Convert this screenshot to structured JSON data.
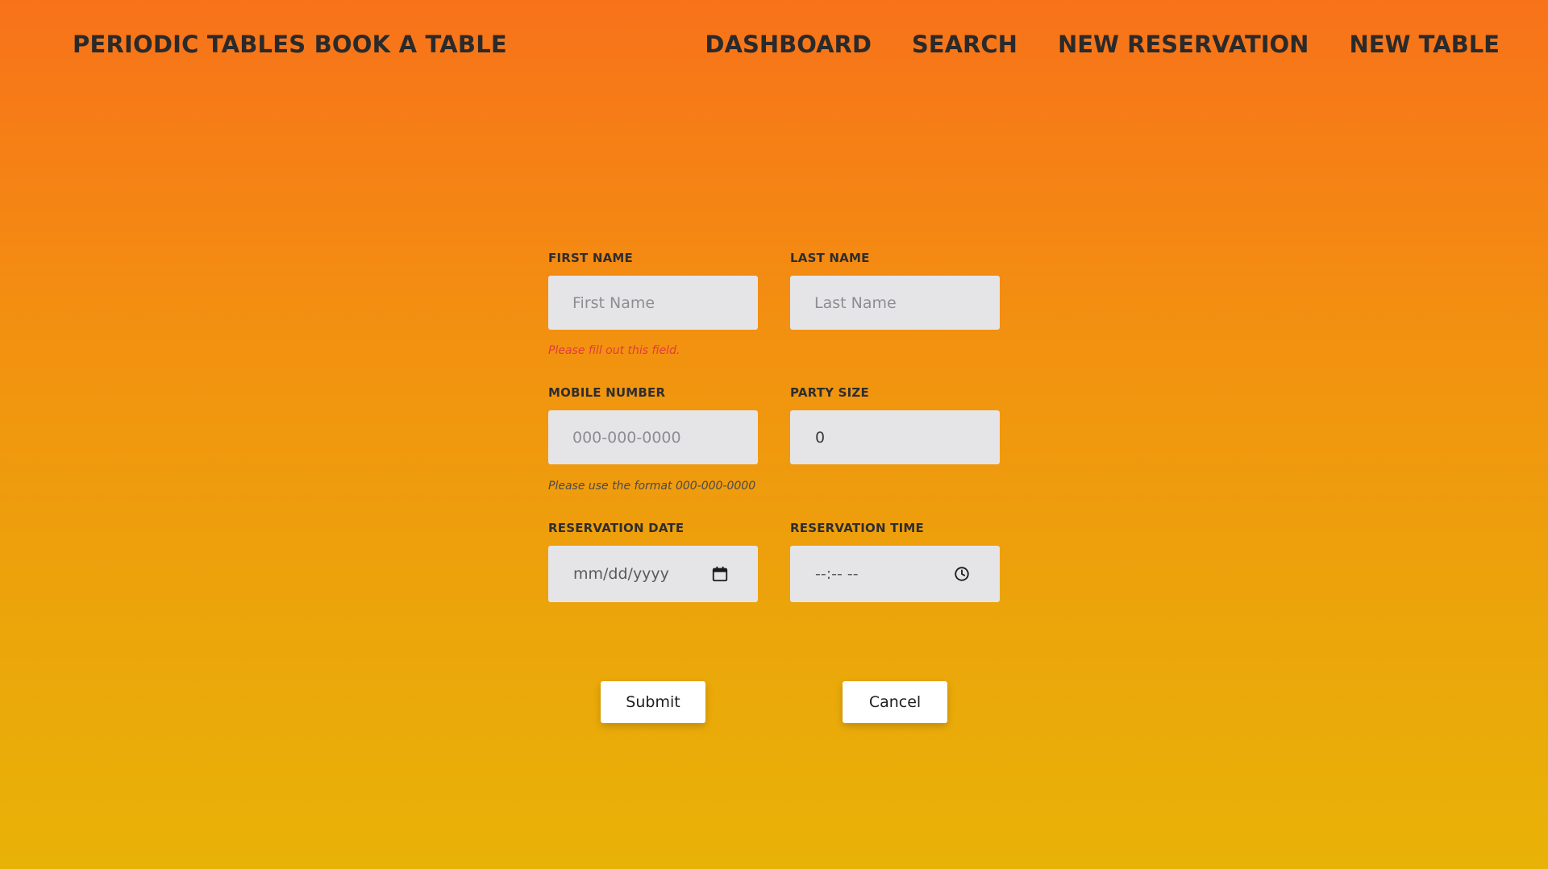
{
  "nav": {
    "brand": "PERIODIC TABLES BOOK A TABLE",
    "links": [
      "DASHBOARD",
      "SEARCH",
      "NEW RESERVATION",
      "NEW TABLE"
    ]
  },
  "form": {
    "first_name": {
      "label": "FIRST NAME",
      "placeholder": "First Name",
      "value": ""
    },
    "last_name": {
      "label": "LAST NAME",
      "placeholder": "Last Name",
      "value": ""
    },
    "first_name_error": "Please fill out this field.",
    "mobile_number": {
      "label": "MOBILE NUMBER",
      "placeholder": "000-000-0000",
      "value": ""
    },
    "party_size": {
      "label": "PARTY SIZE",
      "value": "0"
    },
    "mobile_hint": "Please use the format 000-000-0000",
    "reservation_date": {
      "label": "RESERVATION DATE",
      "placeholder": "mm/dd/yyyy",
      "icon": "calendar-icon"
    },
    "reservation_time": {
      "label": "RESERVATION TIME",
      "placeholder": "--:-- --",
      "icon": "clock-icon"
    },
    "submit_label": "Submit",
    "cancel_label": "Cancel"
  },
  "colors": {
    "gradient_top": "#f8721a",
    "gradient_bottom": "#e9b207",
    "input_bg": "#e5e5e8",
    "error": "#e23b3b"
  }
}
